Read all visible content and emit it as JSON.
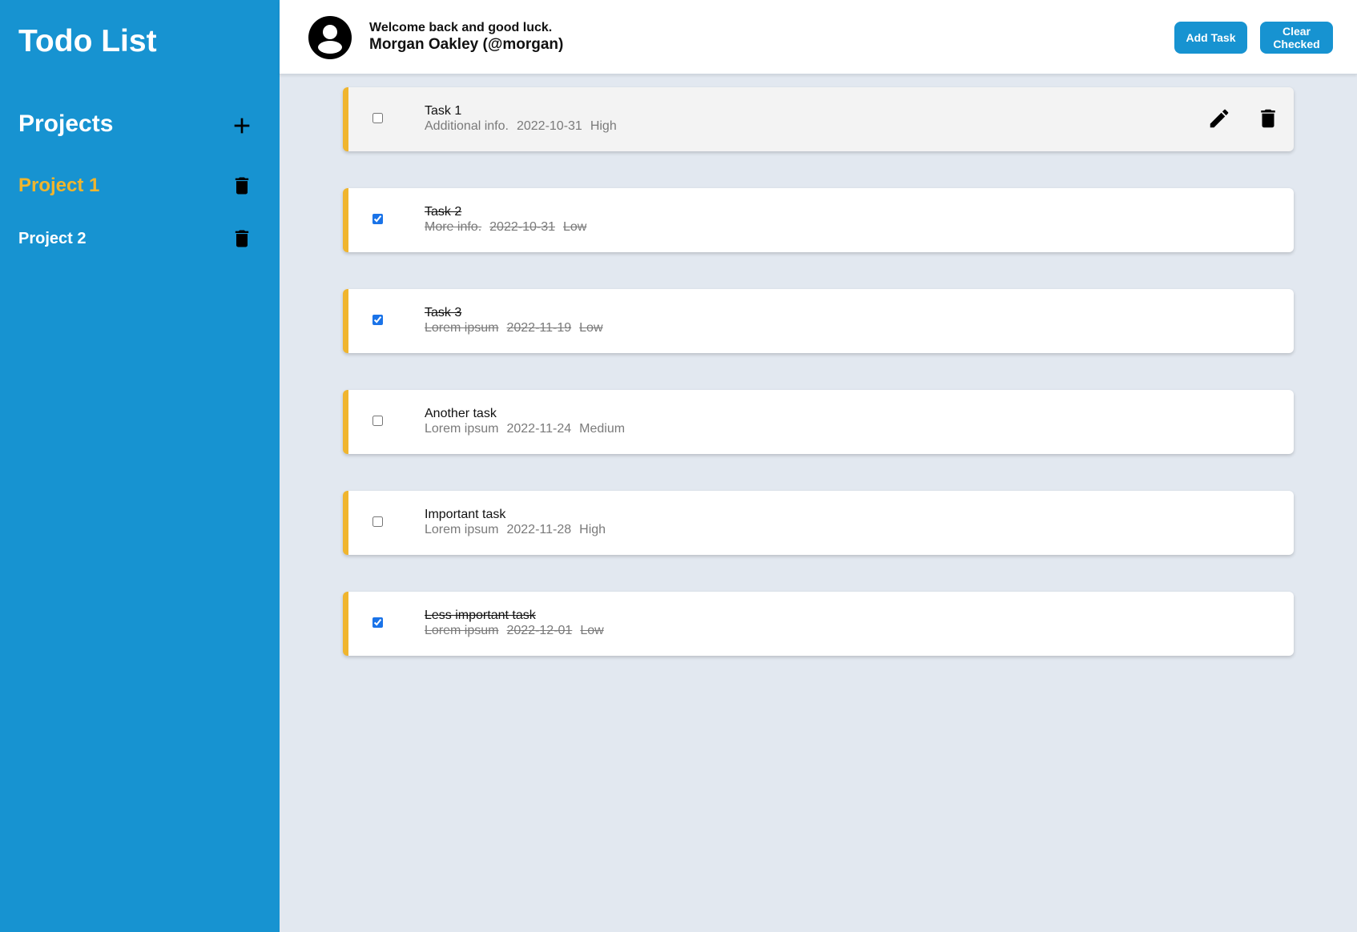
{
  "sidebar": {
    "app_title": "Todo List",
    "projects_heading": "Projects",
    "projects": [
      {
        "name": "Project 1",
        "active": true
      },
      {
        "name": "Project 2",
        "active": false
      }
    ]
  },
  "header": {
    "welcome": "Welcome back and good luck.",
    "user_name": "Morgan Oakley (@morgan)",
    "add_task_label": "Add Task",
    "clear_checked_label": "Clear Checked"
  },
  "tasks": [
    {
      "title": "Task 1",
      "description": "Additional info.",
      "due": "2022-10-31",
      "priority": "High",
      "checked": false
    },
    {
      "title": "Task 2",
      "description": "More info.",
      "due": "2022-10-31",
      "priority": "Low",
      "checked": true
    },
    {
      "title": "Task 3",
      "description": "Lorem ipsum",
      "due": "2022-11-19",
      "priority": "Low",
      "checked": true
    },
    {
      "title": "Another task",
      "description": "Lorem ipsum",
      "due": "2022-11-24",
      "priority": "Medium",
      "checked": false
    },
    {
      "title": "Important task",
      "description": "Lorem ipsum",
      "due": "2022-11-28",
      "priority": "High",
      "checked": false
    },
    {
      "title": "Less important task",
      "description": "Lorem ipsum",
      "due": "2022-12-01",
      "priority": "Low",
      "checked": true
    }
  ],
  "colors": {
    "sidebar_bg": "#1793d1",
    "accent": "#f0b52e",
    "main_bg": "#e2e8f0",
    "button_bg": "#1793d1"
  },
  "icons": {
    "add_project": "plus-icon",
    "project_delete": "trash-icon",
    "avatar": "user-circle-icon",
    "task_edit": "pencil-icon",
    "task_delete": "trash-icon"
  }
}
